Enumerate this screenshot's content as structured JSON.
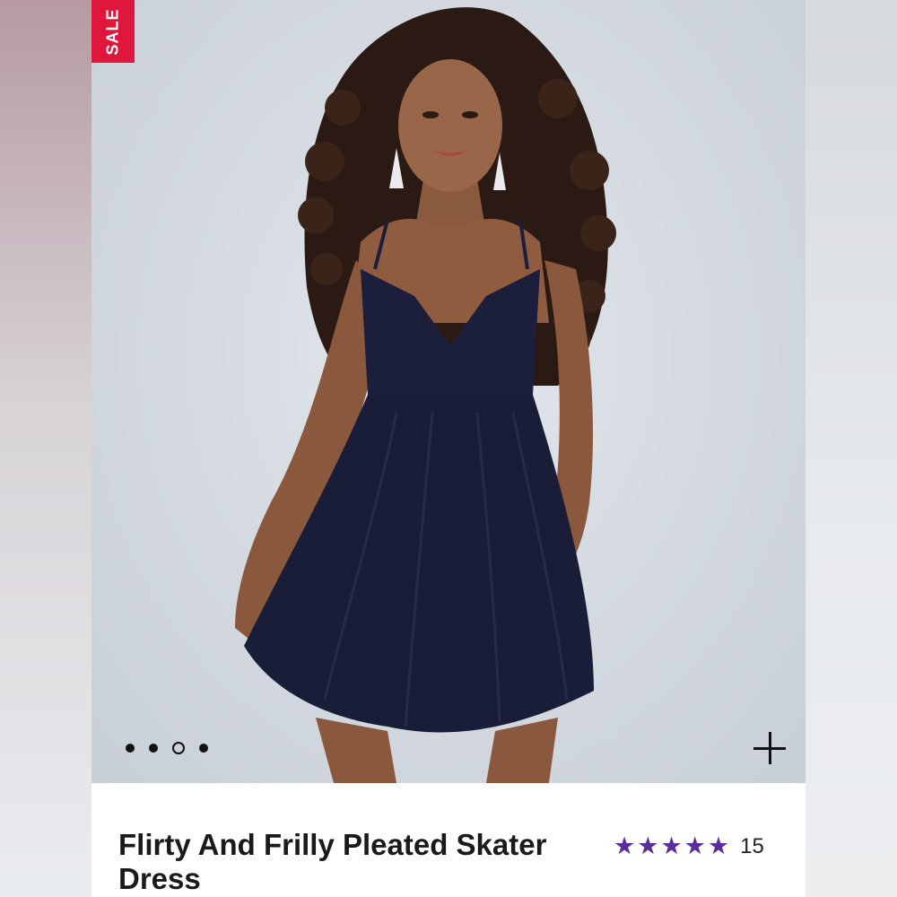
{
  "badge": {
    "label": "SALE"
  },
  "carousel": {
    "count": 4,
    "active": 3
  },
  "product": {
    "title": "Flirty And Frilly Pleated Skater Dress",
    "rating": 5,
    "review_count": "15"
  },
  "colors": {
    "badge": "#e0173d",
    "star": "#5a2d9c",
    "dress": "#1c1f3b"
  },
  "icons": {
    "zoom": "plus-icon",
    "star": "star-icon"
  }
}
